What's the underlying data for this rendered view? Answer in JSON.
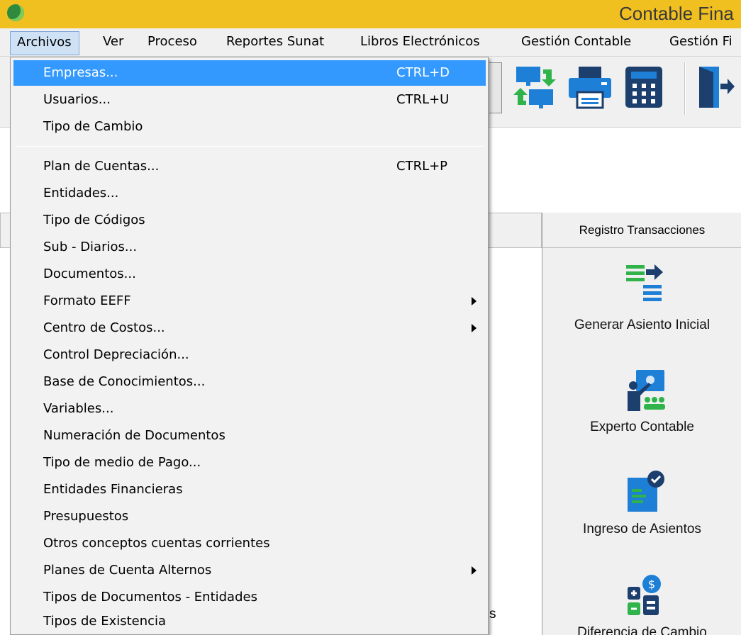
{
  "window": {
    "title": "Contable Fina"
  },
  "menubar": {
    "items": [
      "Archivos",
      "Ver",
      "Proceso",
      "Reportes Sunat",
      "Libros Electrónicos",
      "Gestión Contable",
      "Gestión Fi"
    ]
  },
  "archivos_menu": {
    "items": [
      {
        "label": "Empresas...",
        "shortcut": "CTRL+D",
        "selected": true
      },
      {
        "label": "Usuarios...",
        "shortcut": "CTRL+U"
      },
      {
        "label": "Tipo de Cambio",
        "shortcut": ""
      },
      {
        "label": "Plan de Cuentas...",
        "shortcut": "CTRL+P"
      },
      {
        "label": "Entidades...",
        "shortcut": ""
      },
      {
        "label": "Tipo de Códigos",
        "shortcut": ""
      },
      {
        "label": "Sub - Diarios...",
        "shortcut": ""
      },
      {
        "label": "Documentos...",
        "shortcut": ""
      },
      {
        "label": "Formato EEFF",
        "shortcut": "",
        "submenu": true
      },
      {
        "label": "Centro de Costos...",
        "shortcut": "",
        "submenu": true
      },
      {
        "label": "Control Depreciación...",
        "shortcut": ""
      },
      {
        "label": "Base de Conocimientos...",
        "shortcut": ""
      },
      {
        "label": "Variables...",
        "shortcut": ""
      },
      {
        "label": "Numeración de Documentos",
        "shortcut": ""
      },
      {
        "label": "Tipo de medio de Pago...",
        "shortcut": ""
      },
      {
        "label": "Entidades Financieras",
        "shortcut": ""
      },
      {
        "label": "Presupuestos",
        "shortcut": ""
      },
      {
        "label": "Otros conceptos cuentas corrientes",
        "shortcut": ""
      },
      {
        "label": "Planes de Cuenta Alternos",
        "shortcut": "",
        "submenu": true
      },
      {
        "label": "Tipos de Documentos - Entidades",
        "shortcut": ""
      },
      {
        "label": "Tipos de Existencia",
        "shortcut": ""
      }
    ]
  },
  "toolbar": {
    "icons": [
      "sync-computers-icon",
      "printer-icon",
      "calculator-icon",
      "exit-door-icon"
    ]
  },
  "panel": {
    "header": "Registro Transacciones",
    "actions": [
      {
        "label": "Generar Asiento Inicial",
        "icon": "generate-entry-icon"
      },
      {
        "label": "Experto Contable",
        "icon": "accounting-expert-icon"
      },
      {
        "label": "Ingreso de Asientos",
        "icon": "entries-input-icon"
      },
      {
        "label": "Diferencia de Cambio",
        "icon": "exchange-difference-icon"
      }
    ],
    "left_partial_text": "s"
  },
  "colors": {
    "titlebar": "#f0c020",
    "menu_highlight": "#3399ff",
    "icon_blue": "#1e7fd6",
    "icon_green": "#2fb34a",
    "icon_navy": "#1c3f6e"
  }
}
